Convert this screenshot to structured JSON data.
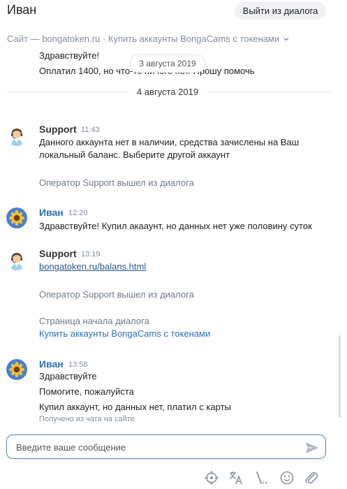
{
  "header": {
    "title": "Иван",
    "exit_label": "Выйти из диалога",
    "source": "Сайт — bongatoken.ru · Купить аккаунты BongaCams с токенами"
  },
  "messages_top": {
    "line1": "Здравствуйте!",
    "line2": "Оплатил 1400, но что-то ничего нет. Прошу помочь",
    "date_pill": "3 августа 2019"
  },
  "date_separator": "4 августа 2019",
  "support1": {
    "author": "Support",
    "time": "11:43",
    "line1": "Данного аккаунта нет в наличии, средства зачислены на Ваш",
    "line2": "локальный баланс. Выберите другой аккаунт",
    "system": "Оператор Support вышел из диалога"
  },
  "ivan1": {
    "author": "Иван",
    "time": "12:20",
    "text": "Здравствуйте! Купил акааунт, но данных нет уже половину суток"
  },
  "support2": {
    "author": "Support",
    "time": "13:19",
    "link": "bongatoken.ru/balans.html",
    "system": "Оператор Support вышел из диалога",
    "page_start_label": "Страница начала диалога",
    "page_start_link": "Купить аккаунты BongaCams с токенами"
  },
  "ivan2": {
    "author": "Иван",
    "time": "13:58",
    "line1": "Здравствуйте",
    "line2": "Помогите, пожалуйста",
    "line3": "Купил аккаунт, но данных нет, платил с карты",
    "received": "Получено из чата на сайте"
  },
  "composer": {
    "placeholder": "Введите ваше сообщение",
    "value": ""
  },
  "toolbar": {
    "icons": [
      "crosshair-icon",
      "translate-icon",
      "template-icon",
      "emoji-icon",
      "attach-icon"
    ]
  },
  "colors": {
    "accent": "#2a6fb5",
    "muted": "#818c99",
    "input_border": "#5181b8"
  }
}
